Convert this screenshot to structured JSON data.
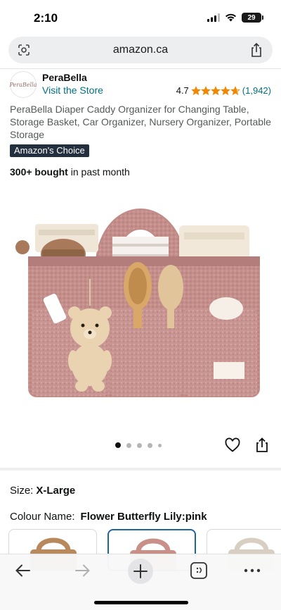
{
  "status": {
    "time": "2:10",
    "battery": "29"
  },
  "browser": {
    "url": "amazon.ca"
  },
  "brand": {
    "logo_text": "PeraBella",
    "name": "PeraBella",
    "visit_store": "Visit the Store"
  },
  "rating": {
    "value": "4.7",
    "stars": 4.7,
    "count": "(1,942)"
  },
  "product": {
    "title": "PeraBella Diaper Caddy Organizer for Changing Table, Storage Basket, Car Organizer, Nursery Organizer, Portable Storage",
    "badge": "Amazon's Choice",
    "bought_bold": "300+ bought",
    "bought_rest": " in past month",
    "image_icon": "diaper-caddy-photo",
    "carousel": {
      "count": 5,
      "active": 1
    }
  },
  "options": {
    "size_label": "Size:",
    "size_value": "X-Large",
    "colour_label": "Colour Name:",
    "colour_value": "Flower Butterfly Lily:pink",
    "swatches": [
      {
        "color": "#b8895c",
        "selected": false
      },
      {
        "color": "#c9908a",
        "selected": true
      },
      {
        "color": "#d8cfc2",
        "selected": false
      }
    ]
  },
  "colors": {
    "link": "#007185",
    "star": "#f08804",
    "badge_bg": "#232f3e",
    "selected_border": "#2162a1",
    "caddy": "#c48e8b"
  }
}
